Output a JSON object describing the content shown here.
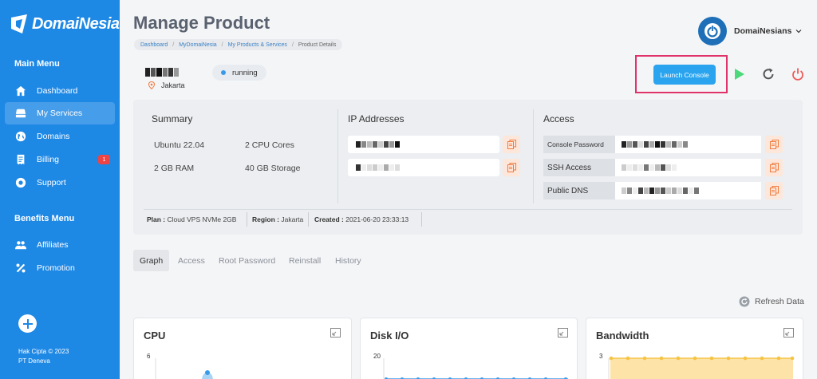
{
  "brand": {
    "name": "DomaiNesia"
  },
  "sidebar": {
    "main_menu_title": "Main Menu",
    "main_items": [
      {
        "label": "Dashboard",
        "icon": "home-icon"
      },
      {
        "label": "My Services",
        "icon": "server-icon",
        "active": true
      },
      {
        "label": "Domains",
        "icon": "globe-icon"
      },
      {
        "label": "Billing",
        "icon": "invoice-icon",
        "badge": "1"
      },
      {
        "label": "Support",
        "icon": "lifebuoy-icon"
      }
    ],
    "benefits_menu_title": "Benefits Menu",
    "benefit_items": [
      {
        "label": "Affiliates",
        "icon": "users-icon"
      },
      {
        "label": "Promotion",
        "icon": "percent-icon"
      }
    ],
    "copyright_line1": "Hak Cipta © 2023",
    "copyright_line2": "PT Deneva"
  },
  "header": {
    "title": "Manage Product",
    "breadcrumb": [
      "Dashboard",
      "MyDomaiNesia",
      "My Products & Services",
      "Product Details"
    ],
    "user": "DomaiNesians"
  },
  "server": {
    "location": "Jakarta",
    "status": "running",
    "launch_label": "Launch Console"
  },
  "summary": {
    "title": "Summary",
    "os": "Ubuntu 22.04",
    "cpu": "2 CPU Cores",
    "ram": "2 GB RAM",
    "storage": "40 GB Storage"
  },
  "ip": {
    "title": "IP Addresses"
  },
  "access": {
    "title": "Access",
    "rows": [
      "Console Password",
      "SSH Access",
      "Public DNS"
    ]
  },
  "meta": {
    "plan_label": "Plan :",
    "plan_value": "Cloud VPS NVMe 2GB",
    "region_label": "Region :",
    "region_value": "Jakarta",
    "created_label": "Created :",
    "created_value": "2021-06-20 23:33:13"
  },
  "tabs": [
    "Graph",
    "Access",
    "Root Password",
    "Reinstall",
    "History"
  ],
  "refresh_label": "Refresh Data",
  "charts": [
    {
      "title": "CPU",
      "ytick": "6"
    },
    {
      "title": "Disk I/O",
      "ytick": "20"
    },
    {
      "title": "Bandwidth",
      "ytick": "3"
    }
  ],
  "colors": {
    "sidebar": "#1e88e5",
    "accent": "#2aa4ee",
    "highlight_frame": "#e0336a",
    "copy_icon": "#f07b3f",
    "play": "#4cd97b",
    "power": "#ef5b5b",
    "bandwidth_fill": "#fde3a8",
    "bandwidth_line": "#f6c445",
    "disk_line": "#3b9ae8"
  }
}
